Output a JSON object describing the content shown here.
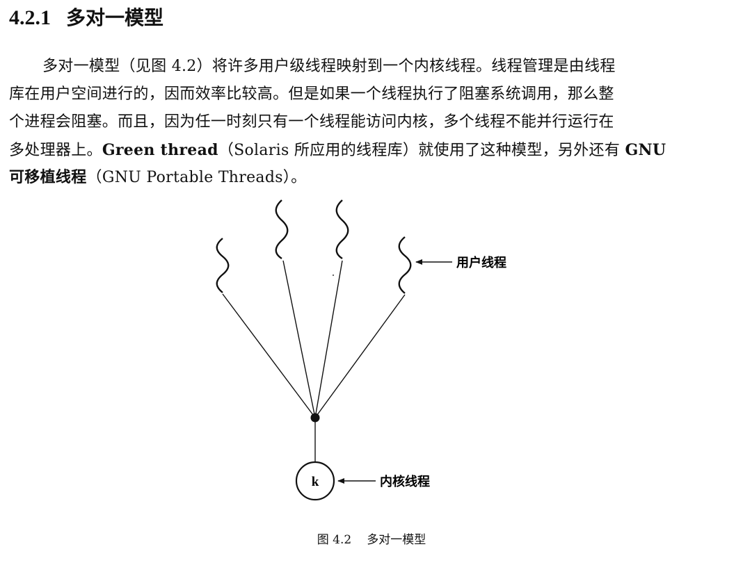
{
  "heading": {
    "number": "4.2.1",
    "title": "多对一模型"
  },
  "paragraph": {
    "line1": "多对一模型（见图 4.2）将许多用户级线程映射到一个内核线程。线程管理是由线程",
    "line2": "库在用户空间进行的，因而效率比较高。但是如果一个线程执行了阻塞系统调用，那么整",
    "line3": "个进程会阻塞。而且，因为任一时刻只有一个线程能访问内核，多个线程不能并行运行在",
    "line4_pre": "多处理器上。",
    "line4_bold": "Green thread",
    "line4_post": "（Solaris 所应用的线程库）就使用了这种模型，另外还有 ",
    "line4_bold2": "GNU",
    "line5_bold": "可移植线程",
    "line5_post": "（GNU Portable Threads）。"
  },
  "diagram": {
    "user_thread_label": "用户线程",
    "kernel_thread_label": "内核线程",
    "kernel_symbol": "k"
  },
  "caption": {
    "figure_number": "图 4.2",
    "title": "多对一模型"
  }
}
